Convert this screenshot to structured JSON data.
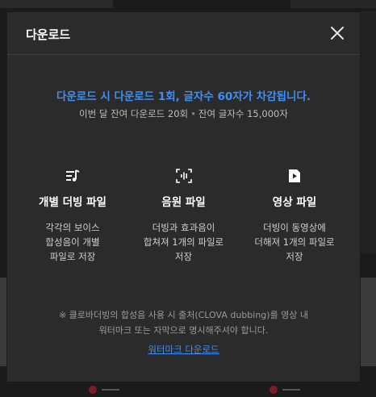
{
  "modal": {
    "title": "다운로드",
    "close_icon": "close-icon"
  },
  "notice": {
    "highlight": "다운로드 시 다운로드 1회, 글자수 60자가 차감됩니다.",
    "remaining_downloads": "이번 달 잔여 다운로드 20회",
    "separator": "•",
    "remaining_chars": "잔여 글자수 15,000자"
  },
  "options": [
    {
      "icon": "music-list-icon",
      "title": "개별 더빙 파일",
      "desc": "각각의 보이스\n합성음이 개별\n파일로 저장"
    },
    {
      "icon": "audio-waveform-icon",
      "title": "음원 파일",
      "desc": "더빙과 효과음이\n합쳐져 1개의 파일로\n저장"
    },
    {
      "icon": "video-file-icon",
      "title": "영상 파일",
      "desc": "더빙이 동영상에\n더해져 1개의 파일로\n저장"
    }
  ],
  "footnote": "※ 클로바더빙의 합성음 사용 시 출처(CLOVA dubbing)를 영상 내\n워터마크 또는 자막으로 명시해주셔야 합니다.",
  "watermark_link": "워터마크 다운로드",
  "colors": {
    "accent": "#3d8ff5",
    "modal_bg": "#2b2b2b"
  }
}
